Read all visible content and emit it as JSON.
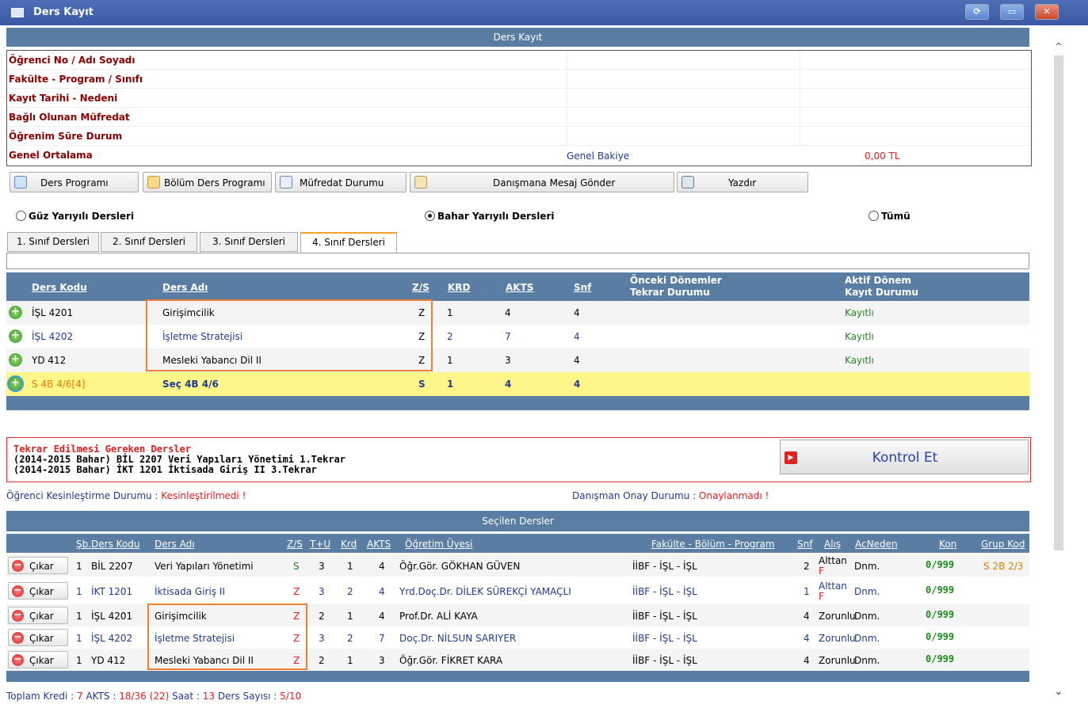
{
  "window": {
    "title": "Ders Kayıt",
    "btn_refresh": "⟳",
    "btn_restore": "▭",
    "btn_close": "✕"
  },
  "section_title": "Ders Kayıt",
  "info": {
    "rows": [
      {
        "label": "Öğrenci No / Adı Soyadı"
      },
      {
        "label": "Fakülte - Program / Sınıfı"
      },
      {
        "label": "Kayıt Tarihi - Nedeni"
      },
      {
        "label": "Bağlı Olunan Müfredat"
      },
      {
        "label": "Öğrenim Süre Durum"
      },
      {
        "label": "Genel Ortalama"
      }
    ],
    "balance_label": "Genel Bakiye",
    "balance_value": "0,00 TL"
  },
  "toolbar": {
    "ders_programi": "Ders Programı",
    "bolum_ders_programi": "Bölüm Ders Programı",
    "mufredat_durumu": "Müfredat Durumu",
    "danismana_mesaj": "Danışmana Mesaj Gönder",
    "yazdir": "Yazdır"
  },
  "semester": {
    "guz": "Güz Yarıyılı Dersleri",
    "bahar": "Bahar Yarıyılı Dersleri",
    "tumu": "Tümü",
    "selected": "bahar"
  },
  "tabs": [
    "1. Sınıf Dersleri",
    "2. Sınıf Dersleri",
    "3. Sınıf Dersleri",
    "4. Sınıf Dersleri"
  ],
  "active_tab": 3,
  "courses_header": {
    "kod": "Ders Kodu",
    "ad": "Ders Adı",
    "zs": "Z/S",
    "krd": "KRD",
    "akts": "AKTS",
    "snf": "Snf",
    "onceki1": "Önceki Dönemler",
    "onceki2": "Tekrar Durumu",
    "aktif1": "Aktif Dönem",
    "aktif2": "Kayıt Durumu"
  },
  "courses": [
    {
      "kod": "İŞL 4201",
      "ad": "Girişimcilik",
      "zs": "Z",
      "krd": "1",
      "akts": "4",
      "snf": "4",
      "durum": "Kayıtlı"
    },
    {
      "kod": "İŞL 4202",
      "ad": "İşletme Stratejisi",
      "zs": "Z",
      "krd": "2",
      "akts": "7",
      "snf": "4",
      "durum": "Kayıtlı"
    },
    {
      "kod": "YD 412",
      "ad": "Mesleki Yabancı Dil II",
      "zs": "Z",
      "krd": "1",
      "akts": "3",
      "snf": "4",
      "durum": "Kayıtlı"
    },
    {
      "kod": "S 4B 4/6[4]",
      "ad": "Seç 4B 4/6",
      "zs": "S",
      "krd": "1",
      "akts": "4",
      "snf": "4",
      "durum": ""
    }
  ],
  "repeat": {
    "title": "Tekrar Edilmesi Gereken Dersler",
    "line1": "(2014-2015 Bahar) BİL 2207 Veri Yapıları Yönetimi 1.Tekrar",
    "line2": "(2014-2015 Bahar) İKT 1201 İktisada Giriş II 3.Tekrar",
    "button": "Kontrol Et"
  },
  "status": {
    "kes_label": "Öğrenci Kesinleştirme Durumu : ",
    "kes_value": "Kesinleştirilmedi !",
    "onay_label": "Danışman Onay Durumu : ",
    "onay_value": "Onaylanmadı !"
  },
  "selected_title": "Seçilen Dersler",
  "selected_header": {
    "sb": "Şb.Ders Kodu",
    "ad": "Ders Adı",
    "zs": "Z/S",
    "tu": "T+U",
    "krd": "Krd",
    "akts": "AKTS",
    "ogr": "Öğretim Üyesi",
    "fak": "Fakülte - Bölüm - Program",
    "snf": "Snf",
    "alis": "Alış",
    "acn": "AcNeden",
    "kon": "Kon",
    "grup": "Grup Kod"
  },
  "selected": [
    {
      "btn": "Çıkar",
      "sb": "1",
      "kod": "BİL 2207",
      "ad": "Veri Yapıları Yönetimi",
      "zs": "S",
      "tu": "3",
      "krd": "1",
      "akts": "4",
      "ogr": "Öğr.Gör. GÖKHAN GÜVEN",
      "fak": "İİBF - İŞL - İŞL",
      "snf": "2",
      "alis1": "Alttan",
      "alis2": "F",
      "acn": "Dnm.",
      "kon": "0/999",
      "grup": "S 2B 2/3"
    },
    {
      "btn": "Çıkar",
      "sb": "1",
      "kod": "İKT 1201",
      "ad": "İktisada Giriş II",
      "zs": "Z",
      "tu": "3",
      "krd": "2",
      "akts": "4",
      "ogr": "Yrd.Doç.Dr. DİLEK SÜREKÇİ YAMAÇLI",
      "fak": "İİBF - İŞL - İŞL",
      "snf": "1",
      "alis1": "Alttan",
      "alis2": "F",
      "acn": "Dnm.",
      "kon": "0/999",
      "grup": ""
    },
    {
      "btn": "Çıkar",
      "sb": "1",
      "kod": "İŞL 4201",
      "ad": "Girişimcilik",
      "zs": "Z",
      "tu": "2",
      "krd": "1",
      "akts": "4",
      "ogr": "Prof.Dr. ALİ KAYA",
      "fak": "İİBF - İŞL - İŞL",
      "snf": "4",
      "alis1": "Zorunlu",
      "alis2": "",
      "acn": "Dnm.",
      "kon": "0/999",
      "grup": ""
    },
    {
      "btn": "Çıkar",
      "sb": "1",
      "kod": "İŞL 4202",
      "ad": "İşletme Stratejisi",
      "zs": "Z",
      "tu": "3",
      "krd": "2",
      "akts": "7",
      "ogr": "Doç.Dr. NİLSUN SARIYER",
      "fak": "İİBF - İŞL - İŞL",
      "snf": "4",
      "alis1": "Zorunlu",
      "alis2": "",
      "acn": "Dnm.",
      "kon": "0/999",
      "grup": ""
    },
    {
      "btn": "Çıkar",
      "sb": "1",
      "kod": "YD 412",
      "ad": "Mesleki Yabancı Dil II",
      "zs": "Z",
      "tu": "2",
      "krd": "1",
      "akts": "3",
      "ogr": "Öğr.Gör. FİKRET KARA",
      "fak": "İİBF - İŞL - İŞL",
      "snf": "4",
      "alis1": "Zorunlu",
      "alis2": "",
      "acn": "Dnm.",
      "kon": "0/999",
      "grup": ""
    }
  ],
  "footer": {
    "kredi_label": "Toplam Kredi : ",
    "kredi": "7",
    "akts_label": " AKTS : ",
    "akts": "18/36 (22)",
    "saat_label": " Saat : ",
    "saat": "13",
    "sayi_label": " Ders Sayısı : ",
    "sayi": "5/10"
  },
  "colors": {
    "header_blue": "#5a7da3",
    "label_red": "#8b0000",
    "highlight_yellow": "#fff68a",
    "accent_orange": "#f08030"
  }
}
